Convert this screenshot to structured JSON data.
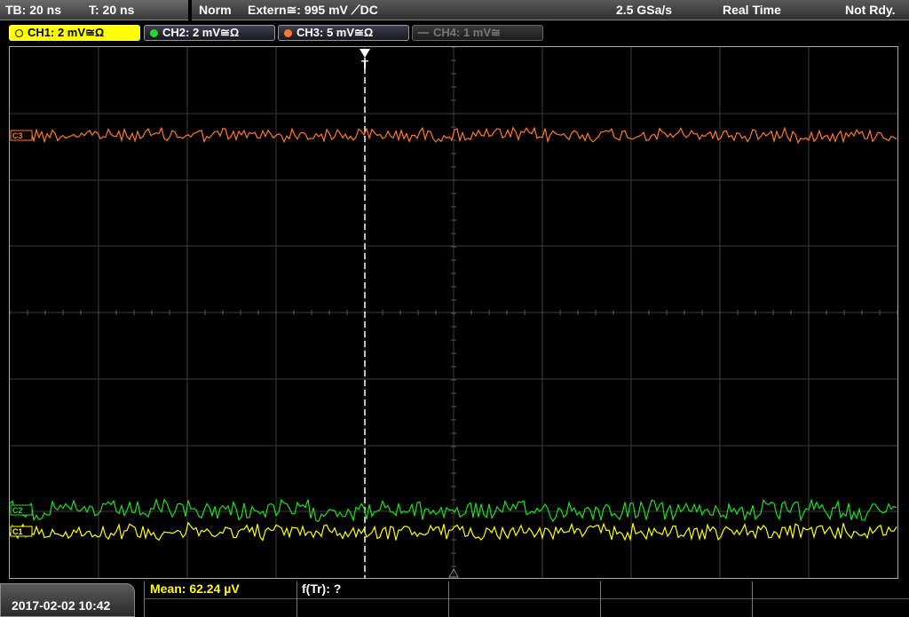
{
  "topbar": {
    "timebase": "TB: 20 ns",
    "trigger_time": "T: 20 ns",
    "mode": "Norm",
    "trigger": "Extern≅: 995 mV ⟋DC",
    "sample_rate": "2.5 GSa/s",
    "acq_mode": "Real Time",
    "status": "Not Rdy."
  },
  "channels": [
    {
      "label": "CH1: 2 mV≅Ω",
      "color": "#ffff00",
      "active": true
    },
    {
      "label": "CH2: 2 mV≅Ω",
      "color": "#22dd22",
      "active": false
    },
    {
      "label": "CH3: 5 mV≅Ω",
      "color": "#ff7a2a",
      "active": false
    },
    {
      "label": "CH4: 1 mV≅",
      "color": "#777777",
      "active": false
    }
  ],
  "markers": {
    "trigger_marker": "T",
    "ch1_marker": "C1",
    "ch2_marker": "C2",
    "ch3_marker": "C3"
  },
  "measurements": {
    "mean": "Mean: 62.24 µV",
    "freq": "f(Tr): ?"
  },
  "datetime": "2017-02-02 10:42",
  "colors": {
    "ch1": "#ffff00",
    "ch2": "#22dd22",
    "ch3": "#ff7a2a",
    "grid": "#3c3c3c",
    "trigger_line": "#ffffff"
  }
}
